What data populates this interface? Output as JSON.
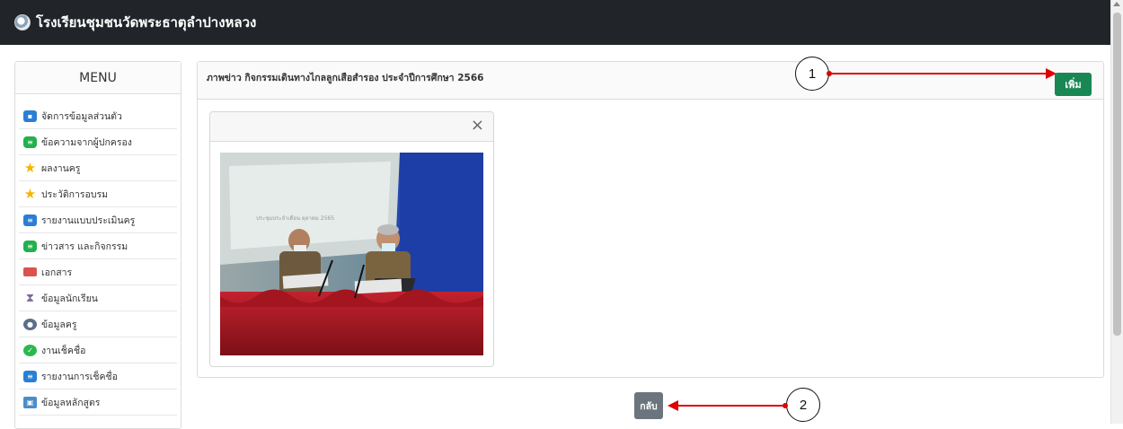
{
  "header": {
    "site_title": "โรงเรียนชุมชนวัดพระธาตุลำปางหลวง",
    "logo_icon": "school-logo-icon"
  },
  "menu": {
    "title": "MENU",
    "items": [
      {
        "label": "จัดการข้อมูลส่วนตัว",
        "icon": "id-card-icon"
      },
      {
        "label": "ข้อความจากผู้ปกครอง",
        "icon": "message-icon"
      },
      {
        "label": "ผลงานครู",
        "icon": "star-icon"
      },
      {
        "label": "ประวัติการอบรม",
        "icon": "star-icon"
      },
      {
        "label": "รายงานแบบประเมินครู",
        "icon": "report-icon"
      },
      {
        "label": "ข่าวสาร และกิจกรรม",
        "icon": "message-icon"
      },
      {
        "label": "เอกสาร",
        "icon": "document-icon"
      },
      {
        "label": "ข้อมูลนักเรียน",
        "icon": "hourglass-icon"
      },
      {
        "label": "ข้อมูลครู",
        "icon": "teacher-icon"
      },
      {
        "label": "งานเช็คชื่อ",
        "icon": "check-icon"
      },
      {
        "label": "รายงานการเช็คชื่อ",
        "icon": "report-icon"
      },
      {
        "label": "ข้อมูลหลักสูตร",
        "icon": "curriculum-icon"
      }
    ]
  },
  "panel": {
    "title": "ภาพข่าว กิจกรรมเดินทางไกลลูกเสือสำรอง ประจำปีการศึกษา 2566",
    "add_label": "เพิ่ม",
    "close_glyph": "×",
    "photo_screen_text": "ประชุมประจำเดือน ตุลาคม 2565"
  },
  "footer": {
    "back_label": "กลับ"
  },
  "annotations": {
    "callout_1": "1",
    "callout_2": "2"
  },
  "colors": {
    "topbar": "#212529",
    "add_button": "#198754",
    "back_button": "#6c757d",
    "annotation_arrow": "#e00000"
  }
}
